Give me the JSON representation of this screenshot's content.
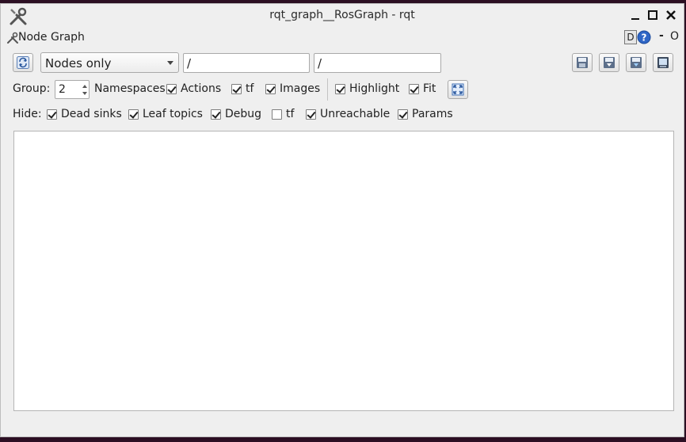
{
  "window": {
    "title": "rqt_graph__RosGraph - rqt",
    "app_icon": "tools-icon",
    "controls": [
      "minimize-icon",
      "maximize-icon",
      "close-icon"
    ]
  },
  "plugin": {
    "title": "Node Graph",
    "d_label": "D",
    "help_icon": "help-icon",
    "dash_label": "-",
    "o_label": "O"
  },
  "toolbar": {
    "refresh_icon": "refresh-icon",
    "view_mode": "Nodes only",
    "node_filter": "/",
    "topic_filter": "/",
    "right_buttons": [
      "load-dot-icon",
      "save-dot-icon",
      "save-svg-icon",
      "save-image-icon"
    ]
  },
  "group_row": {
    "group_label": "Group:",
    "group_value": "2",
    "namespaces_label": "Namespaces",
    "actions": {
      "label": "Actions",
      "checked": true
    },
    "tf": {
      "label": "tf",
      "checked": true
    },
    "images": {
      "label": "Images",
      "checked": true
    },
    "highlight": {
      "label": "Highlight",
      "checked": true
    },
    "fit": {
      "label": "Fit",
      "checked": true
    },
    "fit_icon": "fit-in-view-icon"
  },
  "hide_row": {
    "hide_label": "Hide:",
    "dead_sinks": {
      "label": "Dead sinks",
      "checked": true
    },
    "leaf_topics": {
      "label": "Leaf topics",
      "checked": true
    },
    "debug": {
      "label": "Debug",
      "checked": true
    },
    "tf": {
      "label": "tf",
      "checked": false
    },
    "unreachable": {
      "label": "Unreachable",
      "checked": true
    },
    "params": {
      "label": "Params",
      "checked": true
    }
  }
}
